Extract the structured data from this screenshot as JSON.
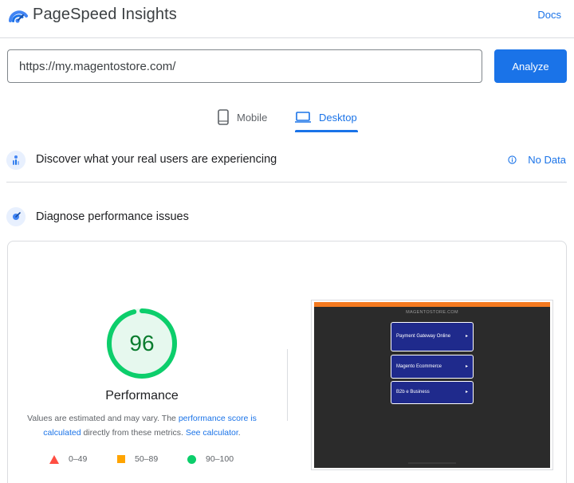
{
  "header": {
    "title": "PageSpeed Insights",
    "docs_label": "Docs"
  },
  "url_bar": {
    "value": "https://my.magentostore.com/",
    "analyze_label": "Analyze"
  },
  "tabs": [
    {
      "label": "Mobile",
      "icon": "phone-icon",
      "selected": false
    },
    {
      "label": "Desktop",
      "icon": "laptop-icon",
      "selected": true
    }
  ],
  "real_users": {
    "title": "Discover what your real users are experiencing",
    "status": "No Data",
    "icon": "users-experience-icon"
  },
  "diagnose": {
    "title": "Diagnose performance issues",
    "icon": "diagnose-icon"
  },
  "performance": {
    "score": "96",
    "score_fraction": 0.96,
    "label": "Performance",
    "desc_prefix": "Values are estimated and may vary. The ",
    "desc_link1": "performance score is calculated",
    "desc_middle": " directly from these metrics. ",
    "desc_link2": "See calculator",
    "desc_suffix": "."
  },
  "legend": [
    {
      "range": "0–49",
      "shape": "triangle",
      "color": "#ff4e42"
    },
    {
      "range": "50–89",
      "shape": "square",
      "color": "#ffa400"
    },
    {
      "range": "90–100",
      "shape": "circle",
      "color": "#0cce6b"
    }
  ],
  "preview": {
    "brand": "MAGENTOSTORE.COM",
    "buttons": [
      {
        "label": "Payment Gateway Online",
        "arrow": "▸"
      },
      {
        "label": "Magento Ecommerce",
        "arrow": "▸"
      },
      {
        "label": "B2b e Business",
        "arrow": "▸"
      }
    ]
  },
  "colors": {
    "accent": "#1a73e8",
    "score_good": "#0cce6b",
    "score_text": "#0a7c2e"
  }
}
